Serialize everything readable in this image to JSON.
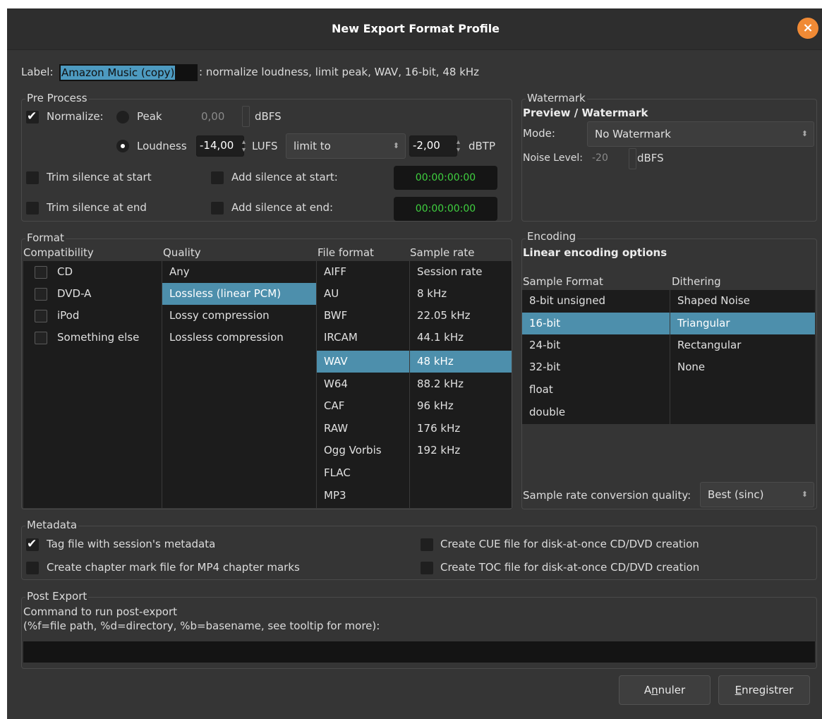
{
  "window": {
    "title": "New Export Format Profile",
    "close_icon": "close-icon"
  },
  "label_row": {
    "label": "Label:",
    "value": "Amazon Music (copy)",
    "description": ": normalize loudness, limit peak, WAV, 16-bit, 48 kHz"
  },
  "preprocess": {
    "legend": "Pre Process",
    "normalize": {
      "label": "Normalize:",
      "checked": true
    },
    "peak": {
      "label": "Peak",
      "value": "0,00",
      "unit": "dBFS",
      "selected": false
    },
    "loudness": {
      "label": "Loudness",
      "value": "-14,00",
      "unit": "LUFS",
      "selected": true
    },
    "limit": {
      "value": "limit to"
    },
    "limit_value": {
      "value": "-2,00",
      "unit": "dBTP"
    },
    "trim_start": {
      "label": "Trim silence at start",
      "checked": false
    },
    "trim_end": {
      "label": "Trim silence at end",
      "checked": false
    },
    "add_start": {
      "label": "Add silence at start:",
      "checked": false,
      "time": "00:00:00:00"
    },
    "add_end": {
      "label": "Add silence at end:",
      "checked": false,
      "time": "00:00:00:00"
    }
  },
  "watermark": {
    "legend": "Watermark",
    "heading": "Preview / Watermark",
    "mode_label": "Mode:",
    "mode_value": "No Watermark",
    "noise_label": "Noise Level:",
    "noise_value": "-20",
    "noise_unit": "dBFS"
  },
  "format": {
    "legend": "Format",
    "headers": {
      "compatibility": "Compatibility",
      "quality": "Quality",
      "file_format": "File format",
      "sample_rate": "Sample rate"
    },
    "compatibility": [
      "CD",
      "DVD-A",
      "iPod",
      "Something else"
    ],
    "quality": [
      "Any",
      "Lossless (linear PCM)",
      "Lossy compression",
      "Lossless compression"
    ],
    "file_formats": [
      "AIFF",
      "AU",
      "BWF",
      "IRCAM",
      "WAV",
      "W64",
      "CAF",
      "RAW",
      "Ogg Vorbis",
      "FLAC",
      "MP3"
    ],
    "sample_rates": [
      "Session rate",
      "8 kHz",
      "22.05 kHz",
      "44.1 kHz",
      "48 kHz",
      "88.2 kHz",
      "96 kHz",
      "176 kHz",
      "192 kHz"
    ],
    "selected_quality": "Lossless (linear PCM)",
    "selected_file_format": "WAV",
    "selected_sample_rate": "48 kHz"
  },
  "encoding": {
    "legend": "Encoding",
    "heading": "Linear encoding options",
    "headers": {
      "sample_format": "Sample Format",
      "dithering": "Dithering"
    },
    "sample_formats": [
      "8-bit unsigned",
      "16-bit",
      "24-bit",
      "32-bit",
      "float",
      "double"
    ],
    "dithering": [
      "Shaped Noise",
      "Triangular",
      "Rectangular",
      "None"
    ],
    "selected_sample_format": "16-bit",
    "selected_dithering": "Triangular",
    "src_label": "Sample rate conversion quality:",
    "src_value": "Best (sinc)"
  },
  "metadata": {
    "legend": "Metadata",
    "tag": {
      "label": "Tag file with session's metadata",
      "checked": true
    },
    "chapter": {
      "label": "Create chapter mark file for MP4 chapter marks",
      "checked": false
    },
    "cue": {
      "label": "Create CUE file for disk-at-once CD/DVD creation",
      "checked": false
    },
    "toc": {
      "label": "Create TOC file for disk-at-once CD/DVD creation",
      "checked": false
    }
  },
  "post_export": {
    "legend": "Post Export",
    "line1": "Command to run post-export",
    "line2": "(%f=file path, %d=directory, %b=basename, see tooltip for more):",
    "command": ""
  },
  "buttons": {
    "cancel": {
      "pre": "A",
      "mnemonic": "n",
      "post": "nuler"
    },
    "save": {
      "pre": "",
      "mnemonic": "E",
      "post": "nregistrer"
    }
  }
}
